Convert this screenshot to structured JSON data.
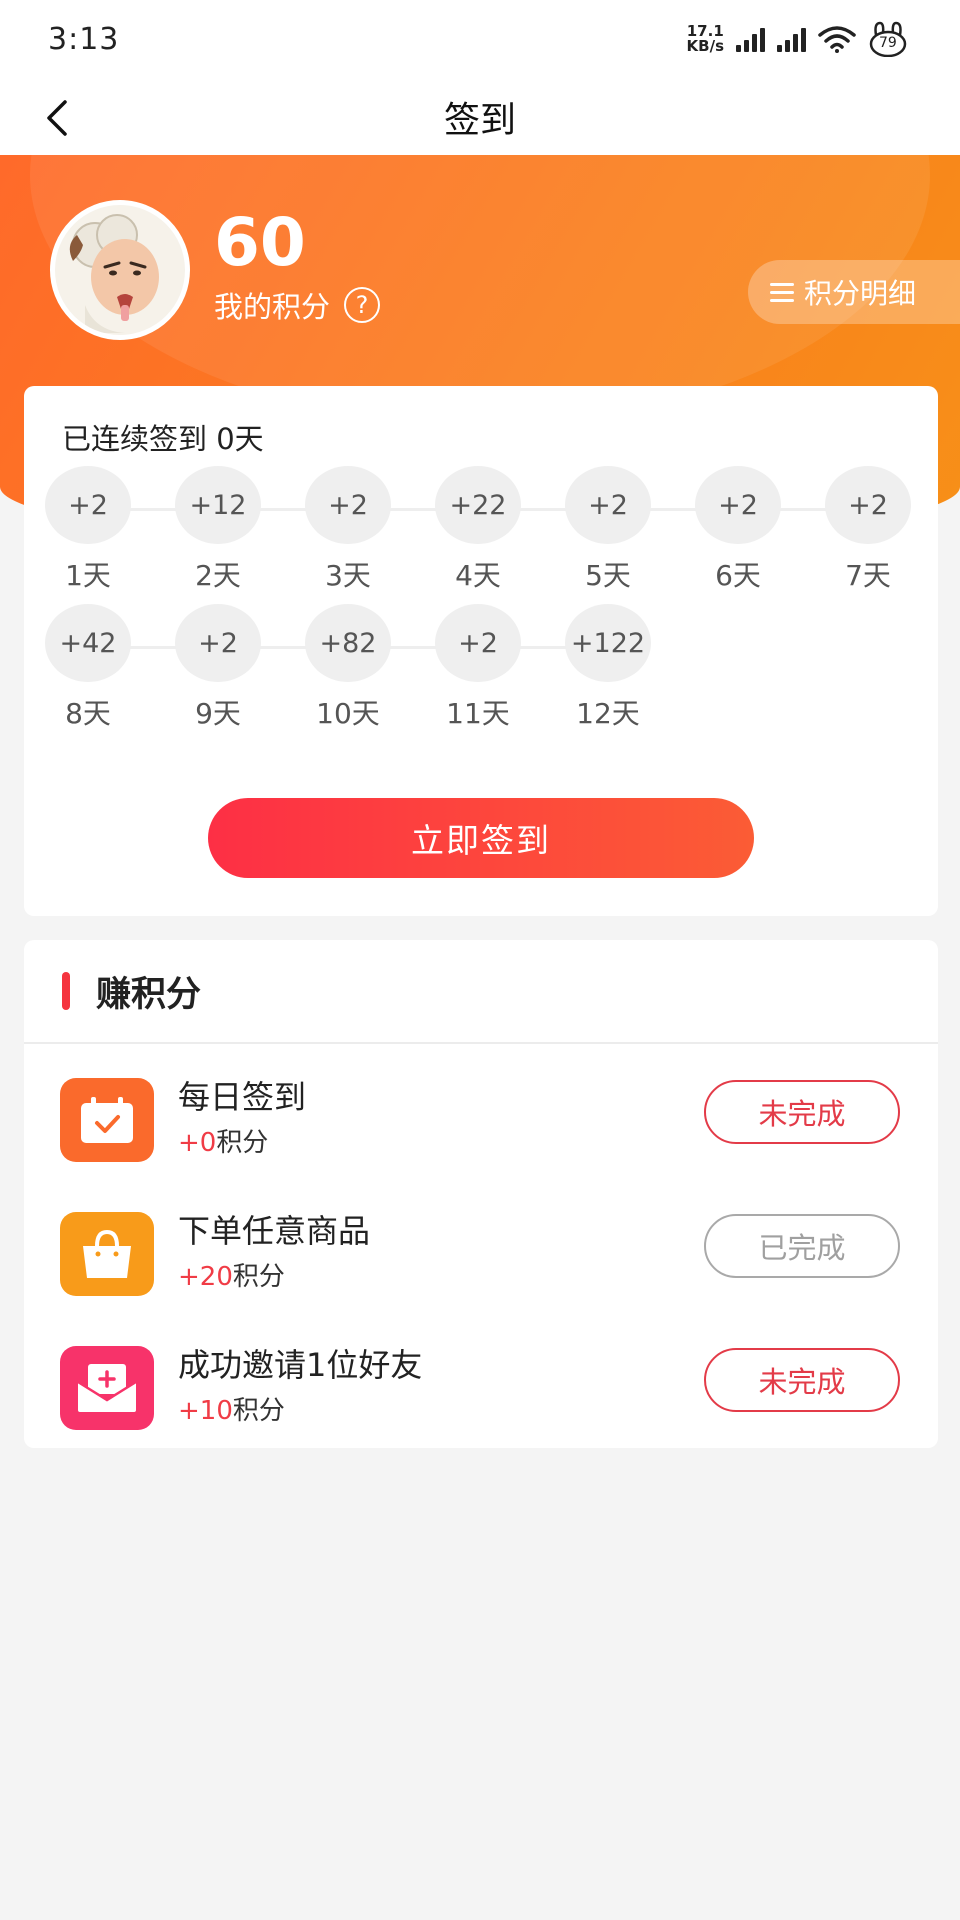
{
  "status_bar": {
    "time": "3:13",
    "net_speed_value": "17.1",
    "net_speed_unit": "KB/s",
    "battery": "79"
  },
  "nav": {
    "title": "签到"
  },
  "profile": {
    "points": "60",
    "points_label": "我的积分",
    "help_glyph": "?",
    "detail_label": "积分明细"
  },
  "signin": {
    "streak_text": "已连续签到 0天",
    "days": [
      {
        "bonus": "+2",
        "label": "1天"
      },
      {
        "bonus": "+12",
        "label": "2天"
      },
      {
        "bonus": "+2",
        "label": "3天"
      },
      {
        "bonus": "+22",
        "label": "4天"
      },
      {
        "bonus": "+2",
        "label": "5天"
      },
      {
        "bonus": "+2",
        "label": "6天"
      },
      {
        "bonus": "+2",
        "label": "7天"
      },
      {
        "bonus": "+42",
        "label": "8天"
      },
      {
        "bonus": "+2",
        "label": "9天"
      },
      {
        "bonus": "+82",
        "label": "10天"
      },
      {
        "bonus": "+2",
        "label": "11天"
      },
      {
        "bonus": "+122",
        "label": "12天"
      }
    ],
    "button_label": "立即签到"
  },
  "earn": {
    "title": "赚积分",
    "tasks": [
      {
        "name": "每日签到",
        "reward_num": "+0",
        "reward_unit": "积分",
        "status": "未完成",
        "icon": "calendar-check-icon",
        "color": "#fa6a2c"
      },
      {
        "name": "下单任意商品",
        "reward_num": "+20",
        "reward_unit": "积分",
        "status": "已完成",
        "icon": "shopping-bag-icon",
        "color": "#f89b1a"
      },
      {
        "name": "成功邀请1位好友",
        "reward_num": "+10",
        "reward_unit": "积分",
        "status": "未完成",
        "icon": "invite-envelope-icon",
        "color": "#f7336a"
      }
    ]
  },
  "colors": {
    "accent_red": "#f5343f",
    "hero_orange": "#fb7a1f"
  }
}
